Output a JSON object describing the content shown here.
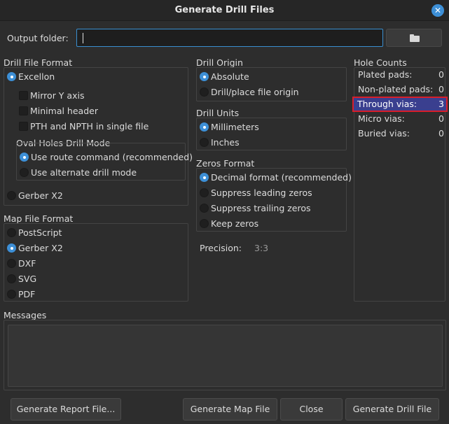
{
  "window": {
    "title": "Generate Drill Files"
  },
  "output_folder": {
    "label": "Output folder:",
    "value": ""
  },
  "drill_file_format": {
    "title": "Drill File Format",
    "excellon": "Excellon",
    "mirror_y": "Mirror Y axis",
    "minimal_header": "Minimal header",
    "pth_npth_single": "PTH and NPTH in single file",
    "oval_title": "Oval Holes Drill Mode",
    "use_route": "Use route command (recommended)",
    "use_alternate": "Use alternate drill mode",
    "gerber_x2": "Gerber X2"
  },
  "map_file_format": {
    "title": "Map File Format",
    "options": [
      "PostScript",
      "Gerber X2",
      "DXF",
      "SVG",
      "PDF"
    ],
    "selected": "Gerber X2"
  },
  "drill_origin": {
    "title": "Drill Origin",
    "options": [
      "Absolute",
      "Drill/place file origin"
    ],
    "selected": "Absolute"
  },
  "drill_units": {
    "title": "Drill Units",
    "options": [
      "Millimeters",
      "Inches"
    ],
    "selected": "Millimeters"
  },
  "zeros_format": {
    "title": "Zeros Format",
    "options": [
      "Decimal format (recommended)",
      "Suppress leading zeros",
      "Suppress trailing zeros",
      "Keep zeros"
    ],
    "selected": "Decimal format (recommended)"
  },
  "precision": {
    "label": "Precision:",
    "value": "3:3"
  },
  "hole_counts": {
    "title": "Hole Counts",
    "rows": [
      {
        "label": "Plated pads:",
        "value": "0"
      },
      {
        "label": "Non-plated pads:",
        "value": "0"
      },
      {
        "label": "Through vias:",
        "value": "3"
      },
      {
        "label": "Micro vias:",
        "value": "0"
      },
      {
        "label": "Buried vias:",
        "value": "0"
      }
    ]
  },
  "messages": {
    "title": "Messages"
  },
  "buttons": {
    "generate_report": "Generate Report File...",
    "generate_map": "Generate Map File",
    "close": "Close",
    "generate_drill": "Generate Drill File"
  },
  "colors": {
    "accent": "#3d8fd6",
    "highlight_border": "#d81e2a",
    "highlight_fill": "#3a3f8f"
  },
  "icons": {
    "close": "close-icon",
    "folder": "folder-icon"
  }
}
